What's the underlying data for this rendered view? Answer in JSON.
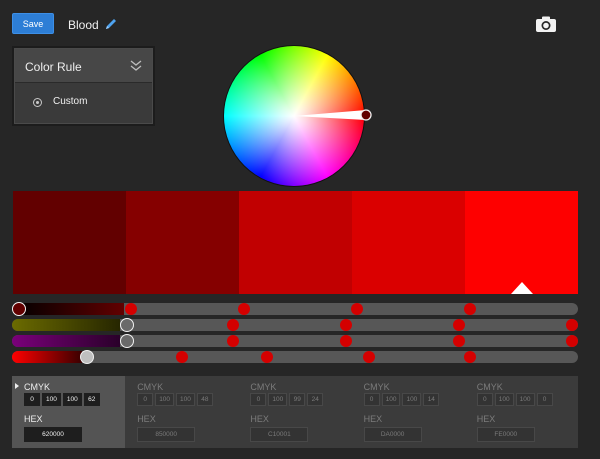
{
  "toolbar": {
    "save_label": "Save",
    "theme_name": "Blood",
    "edit_icon": "pencil-icon",
    "camera_icon": "camera-icon"
  },
  "color_rule": {
    "title": "Color Rule",
    "collapse_icon": "double-chevron-down-icon",
    "selected": "Custom"
  },
  "swatches": [
    {
      "hex": "#620000",
      "cmyk": [
        "0",
        "100",
        "100",
        "62"
      ],
      "hex_label": "620000",
      "active": true
    },
    {
      "hex": "#850000",
      "cmyk": [
        "0",
        "100",
        "100",
        "48"
      ],
      "hex_label": "850000",
      "active": false
    },
    {
      "hex": "#C10001",
      "cmyk": [
        "0",
        "100",
        "99",
        "24"
      ],
      "hex_label": "C10001",
      "active": false
    },
    {
      "hex": "#DA0000",
      "cmyk": [
        "0",
        "100",
        "100",
        "14"
      ],
      "hex_label": "DA0000",
      "active": false
    },
    {
      "hex": "#FE0000",
      "cmyk": [
        "0",
        "100",
        "100",
        "0"
      ],
      "hex_label": "FE0000",
      "active": false
    }
  ],
  "selected_swatch_marker": 4,
  "value_labels": {
    "cmyk": "CMYK",
    "hex": "HEX"
  },
  "sliders": [
    {
      "channel": "brightness",
      "fill_from": "#000000",
      "fill_to": "#620000",
      "knob": 0.0,
      "dots": [
        0.21,
        0.41,
        0.61,
        0.81
      ]
    },
    {
      "channel": "yellow",
      "fill_from": "#6b6b00",
      "fill_to": "#262600",
      "knob": 0.19,
      "dots": [
        0.39,
        0.59,
        0.79,
        0.99
      ]
    },
    {
      "channel": "magenta",
      "fill_from": "#7a007a",
      "fill_to": "#2a002a",
      "knob": 0.19,
      "dots": [
        0.39,
        0.59,
        0.79,
        0.99
      ]
    },
    {
      "channel": "red",
      "fill_from": "#ff0000",
      "fill_to": "#3a0000",
      "knob": 0.12,
      "dots": [
        0.3,
        0.45,
        0.63,
        0.81
      ]
    }
  ]
}
